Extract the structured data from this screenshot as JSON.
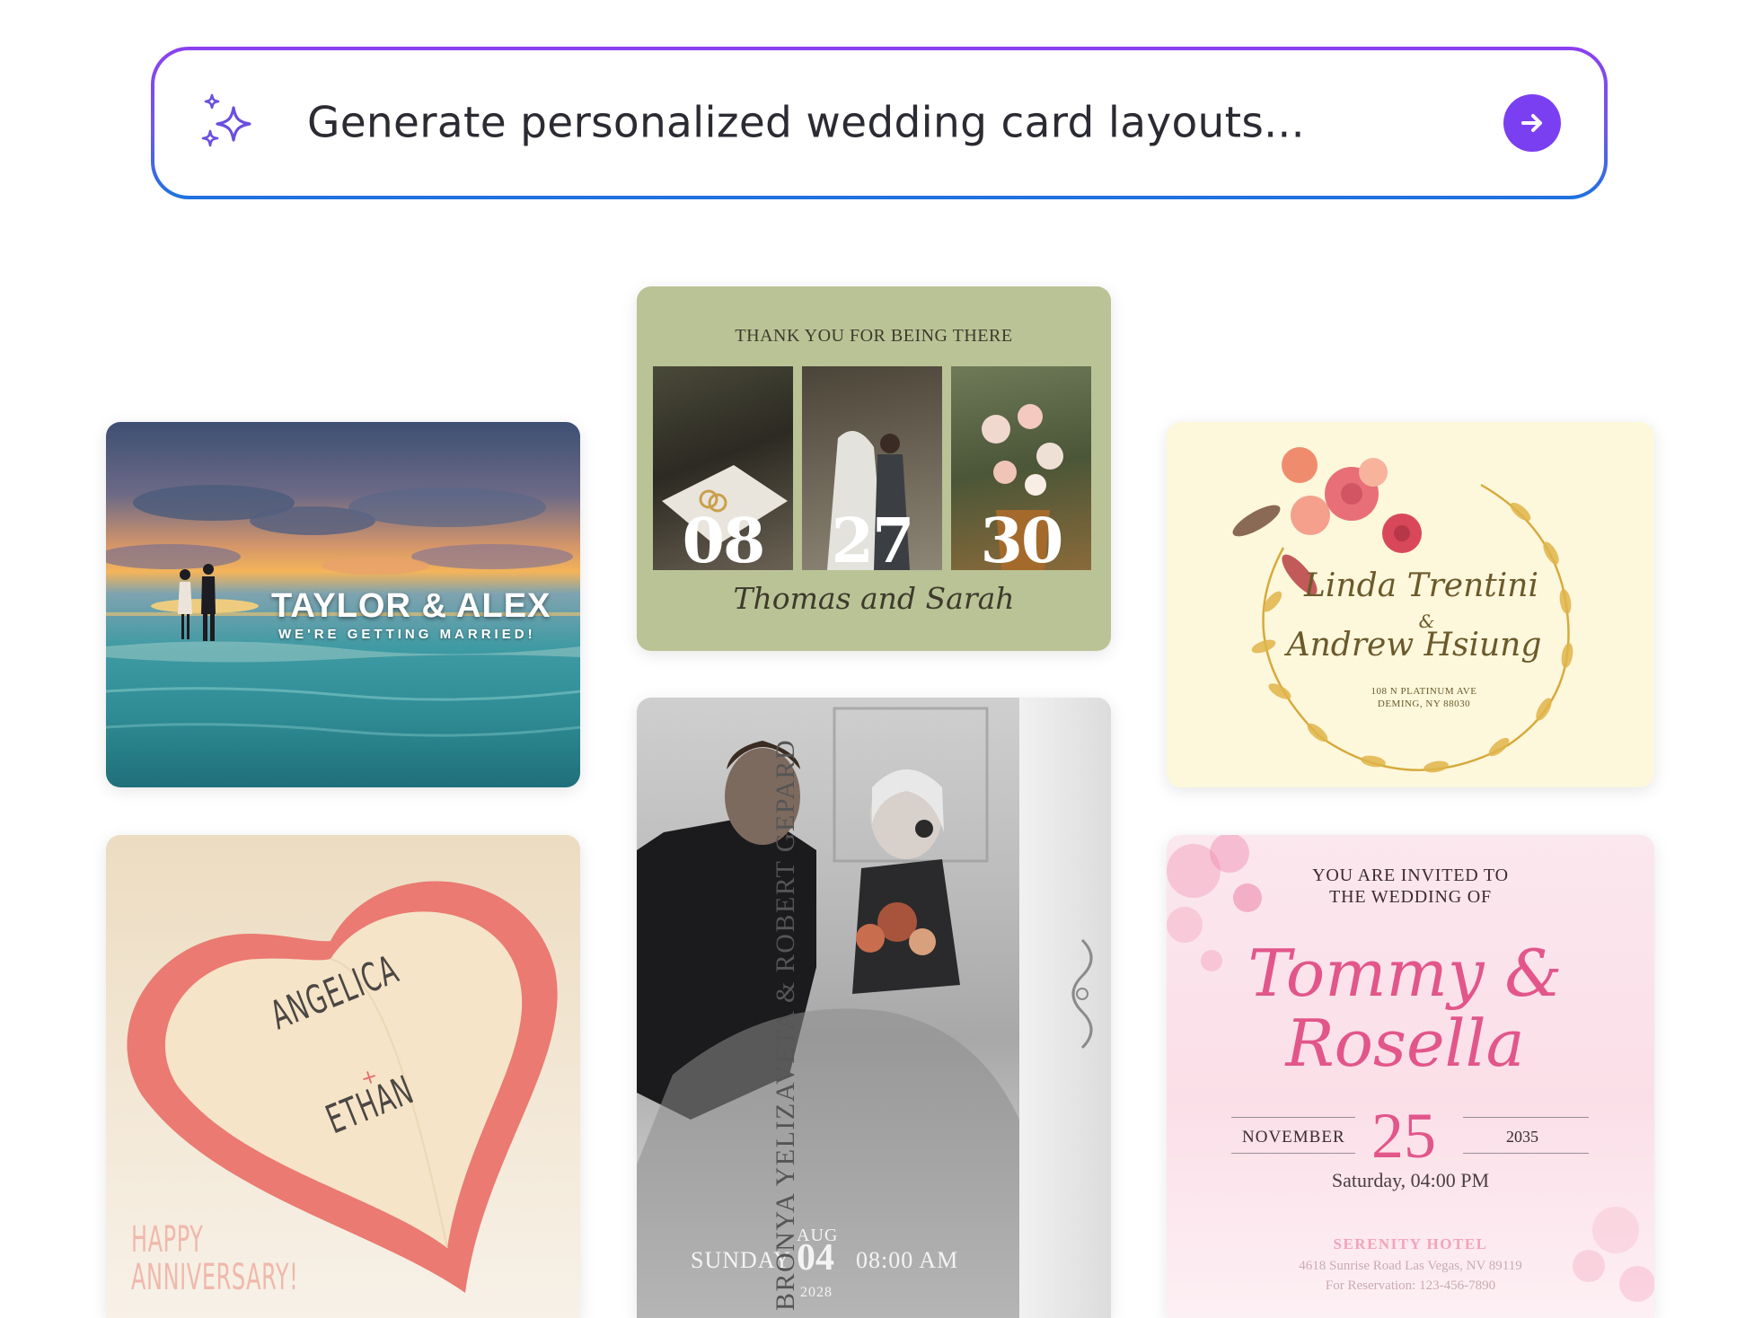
{
  "prompt": {
    "text": "Generate personalized wedding card layouts...",
    "icon": "sparkle-icon",
    "submit_icon": "arrow-right-icon",
    "accent_color": "#7b3ff2"
  },
  "cards": {
    "beach": {
      "title": "TAYLOR & ALEX",
      "subtitle": "WE'RE GETTING MARRIED!"
    },
    "thanks": {
      "heading": "THANK YOU FOR BEING THERE",
      "numbers": [
        "08",
        "27",
        "30"
      ],
      "names": "Thomas and Sarah",
      "background": "#b9c396"
    },
    "wreath": {
      "name1": "Linda Trentini",
      "amp": "&",
      "name2": "Andrew Hsiung",
      "address_line1": "108 N PLATINUM AVE",
      "address_line2": "DEMING, NY 88030"
    },
    "heart": {
      "name1": "ANGELICA",
      "plus": "+",
      "name2": "ETHAN",
      "footer_line1": "HAPPY",
      "footer_line2": "ANNIVERSARY!"
    },
    "portrait": {
      "vertical_text": "BRONYA YELIZAVETA  &  ROBERT GEPARD",
      "month": "AUG",
      "weekday": "SUNDAY",
      "day": "04",
      "time": "08:00 AM",
      "year": "2028"
    },
    "pink": {
      "invite_line1": "YOU ARE INVITED TO",
      "invite_line2": "THE WEDDING OF",
      "names_line1": "Tommy &",
      "names_line2": "Rosella",
      "month": "NOVEMBER",
      "day": "25",
      "year": "2035",
      "time": "Saturday, 04:00 PM",
      "venue": "SERENITY HOTEL",
      "address": "4618 Sunrise Road Las Vegas, NV 89119",
      "reservation": "For Reservation: 123-456-7890",
      "accent": "#e2568a"
    }
  }
}
